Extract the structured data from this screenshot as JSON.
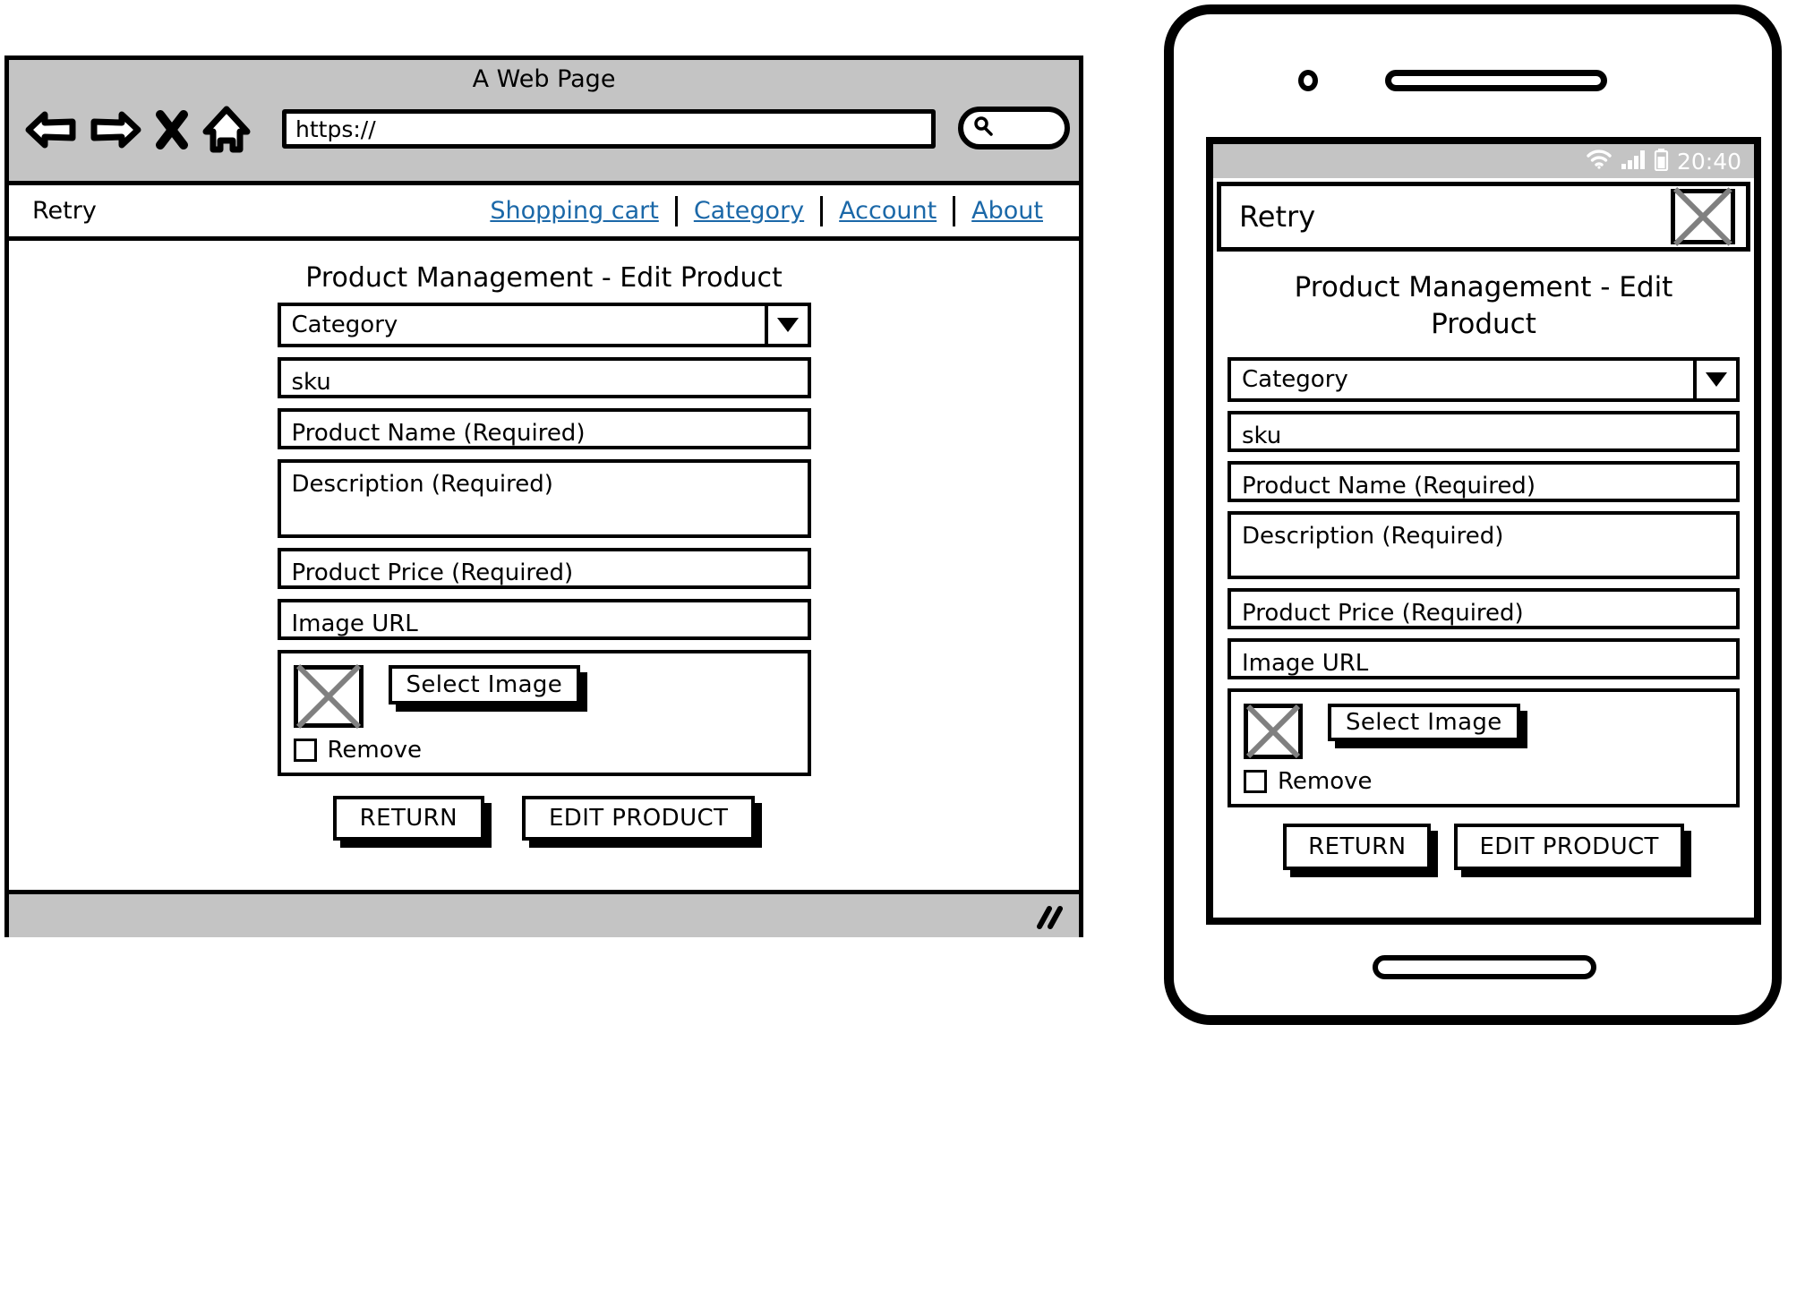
{
  "desktop": {
    "browser": {
      "window_title": "A Web Page",
      "address_value": "https://",
      "nav_icons": [
        "back-arrow-icon",
        "forward-arrow-icon",
        "close-x-icon",
        "home-icon"
      ],
      "search_icon": "magnifier-icon",
      "resize_grip_icon": "resize-grip-icon"
    },
    "site_nav": {
      "brand": "Retry",
      "links": [
        "Shopping cart",
        "Category",
        "Account",
        "About"
      ]
    },
    "page": {
      "title": "Product Management - Edit Product",
      "category_select": {
        "value": "Category",
        "caret_icon": "chevron-down-icon"
      },
      "fields": [
        {
          "name": "sku",
          "placeholder": "sku",
          "multiline": false
        },
        {
          "name": "product-name",
          "placeholder": "Product Name (Required)",
          "multiline": false
        },
        {
          "name": "description",
          "placeholder": "Description (Required)",
          "multiline": true
        },
        {
          "name": "product-price",
          "placeholder": "Product Price (Required)",
          "multiline": false
        },
        {
          "name": "image-url",
          "placeholder": "Image URL",
          "multiline": false
        }
      ],
      "image_panel": {
        "thumbnail_icon": "image-placeholder-icon",
        "select_image_label": "Select Image",
        "remove_label": "Remove",
        "remove_checked": false
      },
      "buttons": {
        "return_label": "RETURN",
        "submit_label": "EDIT PRODUCT"
      }
    }
  },
  "mobile": {
    "status_bar": {
      "wifi_icon": "wifi-icon",
      "signal_icon": "signal-bars-icon",
      "battery_icon": "battery-icon",
      "time": "20:40"
    },
    "app_bar": {
      "brand": "Retry",
      "menu_icon": "image-placeholder-icon"
    },
    "page": {
      "title": "Product Management - Edit Product",
      "category_select": {
        "value": "Category",
        "caret_icon": "chevron-down-icon"
      },
      "fields": [
        {
          "name": "sku",
          "placeholder": "sku",
          "multiline": false
        },
        {
          "name": "product-name",
          "placeholder": "Product Name (Required)",
          "multiline": false
        },
        {
          "name": "description",
          "placeholder": "Description (Required)",
          "multiline": true
        },
        {
          "name": "product-price",
          "placeholder": "Product Price (Required)",
          "multiline": false
        },
        {
          "name": "image-url",
          "placeholder": "Image URL",
          "multiline": false
        }
      ],
      "image_panel": {
        "thumbnail_icon": "image-placeholder-icon",
        "select_image_label": "Select Image",
        "remove_label": "Remove",
        "remove_checked": false
      },
      "buttons": {
        "return_label": "RETURN",
        "submit_label": "EDIT PRODUCT"
      }
    },
    "device": {
      "camera_icon": "camera-dot-icon",
      "speaker_icon": "earpiece-speaker-icon",
      "home_button_icon": "home-button-icon"
    }
  },
  "colors": {
    "chrome_gray": "#c4c4c4",
    "link_blue": "#1b68a8",
    "ink": "#000000",
    "placeholder_x": "#808080"
  }
}
